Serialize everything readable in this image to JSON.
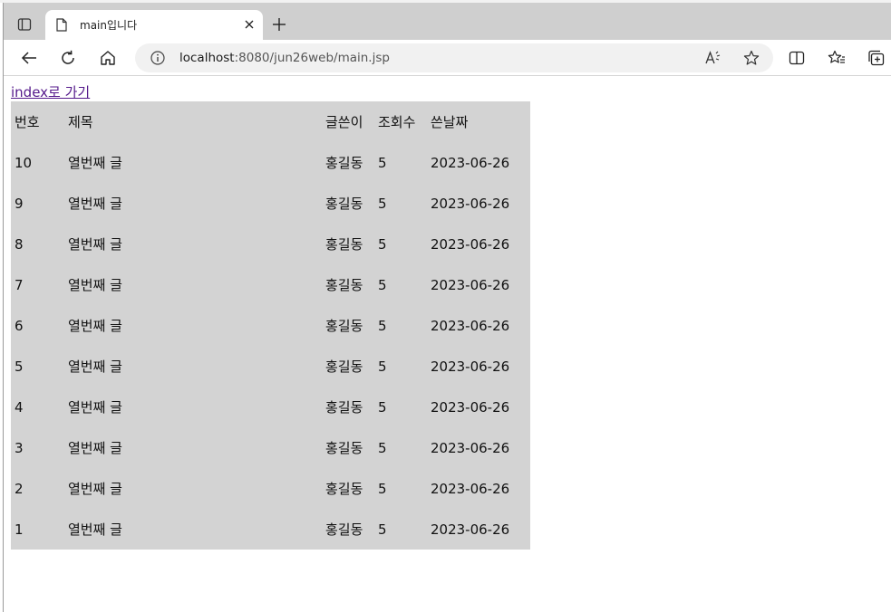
{
  "browser": {
    "tab_title": "main입니다",
    "url_host": "localhost",
    "url_rest": ":8080/jun26web/main.jsp"
  },
  "page": {
    "link_text": "index로 가기",
    "table": {
      "headers": [
        "번호",
        "제목",
        "글쓴이",
        "조회수",
        "쓴날짜"
      ],
      "rows": [
        [
          "10",
          "열번째 글",
          "홍길동",
          "5",
          "2023-06-26"
        ],
        [
          "9",
          "열번째 글",
          "홍길동",
          "5",
          "2023-06-26"
        ],
        [
          "8",
          "열번째 글",
          "홍길동",
          "5",
          "2023-06-26"
        ],
        [
          "7",
          "열번째 글",
          "홍길동",
          "5",
          "2023-06-26"
        ],
        [
          "6",
          "열번째 글",
          "홍길동",
          "5",
          "2023-06-26"
        ],
        [
          "5",
          "열번째 글",
          "홍길동",
          "5",
          "2023-06-26"
        ],
        [
          "4",
          "열번째 글",
          "홍길동",
          "5",
          "2023-06-26"
        ],
        [
          "3",
          "열번째 글",
          "홍길동",
          "5",
          "2023-06-26"
        ],
        [
          "2",
          "열번째 글",
          "홍길동",
          "5",
          "2023-06-26"
        ],
        [
          "1",
          "열번째 글",
          "홍길동",
          "5",
          "2023-06-26"
        ]
      ]
    }
  },
  "icons": {
    "tab_actions": "tab-actions-icon",
    "page": "document-icon",
    "close": "close-icon",
    "new_tab": "plus-icon",
    "back": "back-arrow-icon",
    "refresh": "refresh-icon",
    "home": "home-icon",
    "info": "info-icon",
    "read_aloud": "read-aloud-icon",
    "favorite": "star-icon",
    "split_screen": "split-screen-icon",
    "favorites": "favorites-icon",
    "collections": "collections-icon"
  },
  "colors": {
    "table_bg": "#d3d3d3",
    "link_visited": "#551a8b",
    "tabstrip_bg": "#cfcfcf"
  }
}
